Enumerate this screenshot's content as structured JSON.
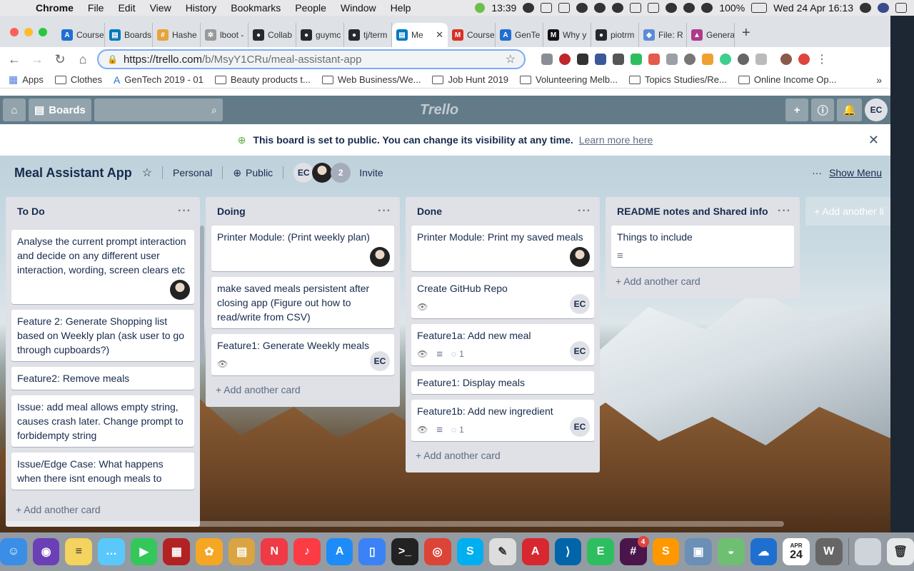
{
  "menubar": {
    "app": "Chrome",
    "items": [
      "File",
      "Edit",
      "View",
      "History",
      "Bookmarks",
      "People",
      "Window",
      "Help"
    ],
    "timer": "13:39",
    "battery": "100%",
    "datetime": "Wed 24 Apr  16:13"
  },
  "browser": {
    "tabs": [
      {
        "label": "Course",
        "color": "#1f6fd1",
        "glyph": "A"
      },
      {
        "label": "Boards",
        "color": "#0079bf",
        "glyph": "▤"
      },
      {
        "label": "Hashe",
        "color": "#e8a33d",
        "glyph": "#"
      },
      {
        "label": "lboot -",
        "color": "#999999",
        "glyph": "✲"
      },
      {
        "label": "Collab",
        "color": "#24292e",
        "glyph": "●"
      },
      {
        "label": "guymc",
        "color": "#24292e",
        "glyph": "●"
      },
      {
        "label": "tj/term",
        "color": "#24292e",
        "glyph": "●"
      },
      {
        "label": "Me",
        "color": "#0079bf",
        "glyph": "▤"
      },
      {
        "label": "Course",
        "color": "#d93025",
        "glyph": "M"
      },
      {
        "label": "GenTe",
        "color": "#1f6fd1",
        "glyph": "A"
      },
      {
        "label": "Why y",
        "color": "#111111",
        "glyph": "M"
      },
      {
        "label": "piotrm",
        "color": "#24292e",
        "glyph": "●"
      },
      {
        "label": "File: R",
        "color": "#5b8bd6",
        "glyph": "◆"
      },
      {
        "label": "Genera",
        "color": "#b03a8a",
        "glyph": "▲"
      }
    ],
    "active_tab": 7,
    "url_host": "https://trello.com",
    "url_path": "/b/MsyY1CRu/meal-assistant-app",
    "bookmarks": [
      "Apps",
      "Clothes",
      "GenTech 2019 - 01",
      "Beauty products t...",
      "Web Business/We...",
      "Job Hunt 2019",
      "Volunteering Melb...",
      "Topics Studies/Re...",
      "Online Income Op..."
    ],
    "bookmarks_more": "»"
  },
  "trello": {
    "boards_label": "Boards",
    "logo": "Trello",
    "user_initials": "EC",
    "banner": {
      "message": "This board is set to public. You can change its visibility at any time.",
      "link": "Learn more here"
    },
    "board": {
      "title": "Meal Assistant App",
      "team": "Personal",
      "visibility": "Public",
      "member_initials": "EC",
      "member_count": "2",
      "invite": "Invite",
      "show_menu": "Show Menu"
    },
    "add_card": "+ Add another card",
    "add_list": "+ Add another li",
    "lists": [
      {
        "title": "To Do",
        "cards": [
          {
            "text": "Analyse the current prompt interaction and decide on any different user interaction, wording, screen clears etc",
            "member": "photo"
          },
          {
            "text": "Feature 2: Generate Shopping list based on Weekly plan (ask user to go through cupboards?)"
          },
          {
            "text": "Feature2: Remove meals"
          },
          {
            "text": "Issue: add meal allows empty string, causes crash later. Change prompt to forbidempty string"
          },
          {
            "text": "Issue/Edge Case: What happens when there isnt enough meals to"
          }
        ]
      },
      {
        "title": "Doing",
        "cards": [
          {
            "text": "Printer Module: (Print weekly plan)",
            "member": "photo"
          },
          {
            "text": "make saved meals persistent after closing app (Figure out how to read/write from CSV)"
          },
          {
            "text": "Feature1: Generate Weekly meals",
            "watch": true,
            "member": "EC"
          }
        ]
      },
      {
        "title": "Done",
        "cards": [
          {
            "text": "Printer Module: Print my saved meals",
            "member": "photo"
          },
          {
            "text": "Create GitHub Repo",
            "watch": true,
            "member": "EC"
          },
          {
            "text": "Feature1a: Add new meal",
            "watch": true,
            "description": true,
            "comments": "1",
            "member": "EC"
          },
          {
            "text": "Feature1: Display meals"
          },
          {
            "text": "Feature1b: Add new ingredient",
            "watch": true,
            "description": true,
            "comments": "1",
            "member": "EC"
          }
        ]
      },
      {
        "title": "README notes and Shared info",
        "cards": [
          {
            "text": "Things to include",
            "description": true
          }
        ]
      }
    ]
  },
  "dock": {
    "apps": [
      {
        "name": "finder",
        "color": "#3a8ee6",
        "glyph": "☺"
      },
      {
        "name": "siri",
        "color": "#6b3fb5",
        "glyph": "◉"
      },
      {
        "name": "notes",
        "color": "#f4d35e",
        "glyph": "≡"
      },
      {
        "name": "messages",
        "color": "#5ac8fa",
        "glyph": "…"
      },
      {
        "name": "facetime",
        "color": "#34c759",
        "glyph": "▶"
      },
      {
        "name": "photo-booth",
        "color": "#b22222",
        "glyph": "▦"
      },
      {
        "name": "photos",
        "color": "#f5a623",
        "glyph": "✿"
      },
      {
        "name": "preview",
        "color": "#d9a441",
        "glyph": "▤"
      },
      {
        "name": "news",
        "color": "#ef3b45",
        "glyph": "N"
      },
      {
        "name": "music",
        "color": "#fc3c44",
        "glyph": "♪"
      },
      {
        "name": "app-store",
        "color": "#1d8cf8",
        "glyph": "A"
      },
      {
        "name": "files",
        "color": "#3b82f6",
        "glyph": "▯"
      },
      {
        "name": "terminal",
        "color": "#222222",
        "glyph": ">_"
      },
      {
        "name": "chrome",
        "color": "#db4437",
        "glyph": "◎"
      },
      {
        "name": "skype",
        "color": "#00aff0",
        "glyph": "S"
      },
      {
        "name": "textedit",
        "color": "#dddddd",
        "glyph": "✎"
      },
      {
        "name": "acrobat",
        "color": "#d7282f",
        "glyph": "A"
      },
      {
        "name": "vscode",
        "color": "#0065a9",
        "glyph": "⟩"
      },
      {
        "name": "evernote",
        "color": "#2dbe60",
        "glyph": "E"
      },
      {
        "name": "slack",
        "color": "#4a154b",
        "glyph": "#",
        "badge": "4"
      },
      {
        "name": "sublime",
        "color": "#ff9800",
        "glyph": "S"
      },
      {
        "name": "image-viewer",
        "color": "#6b8fb5",
        "glyph": "▣"
      },
      {
        "name": "vpn",
        "color": "#6fbf73",
        "glyph": "◒"
      },
      {
        "name": "cloud-app",
        "color": "#1f6fd1",
        "glyph": "☁"
      },
      {
        "name": "calendar",
        "color": "#ffffff",
        "glyph": "24",
        "month": "APR"
      },
      {
        "name": "wordpress",
        "color": "#666666",
        "glyph": "W"
      }
    ],
    "trailing": [
      {
        "name": "desktop-folder",
        "color": "#cfd4da",
        "glyph": ""
      },
      {
        "name": "trash",
        "color": "#e6e8ea",
        "glyph": "🗑"
      }
    ]
  },
  "colors": {
    "list_bg": "#dfe1e6",
    "card_text": "#172b4d",
    "muted": "#5e6c84"
  }
}
